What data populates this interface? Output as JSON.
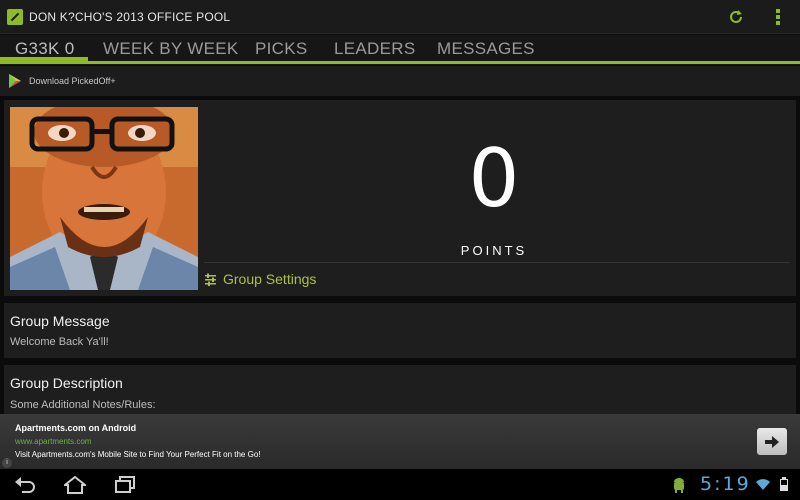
{
  "app": {
    "title": "DON K?CHO'S 2013 OFFICE POOL"
  },
  "tabs": [
    {
      "label": "G33K 0",
      "active": true
    },
    {
      "label": "WEEK BY WEEK",
      "active": false
    },
    {
      "label": "PICKS",
      "active": false
    },
    {
      "label": "LEADERS",
      "active": false
    },
    {
      "label": "MESSAGES",
      "active": false
    }
  ],
  "promo": {
    "label": "Download PickedOff+"
  },
  "profile": {
    "points_value": "0",
    "points_label": "POINTS",
    "settings_label": "Group Settings"
  },
  "group_message": {
    "title": "Group Message",
    "body": "Welcome Back Ya'll!"
  },
  "group_description": {
    "title": "Group Description",
    "body": "Some Additional Notes/Rules:"
  },
  "ad": {
    "title": "Apartments.com on Android",
    "url": "www.apartments.com",
    "description": "Visit Apartments.com's Mobile Site to Find Your Perfect Fit on the Go!"
  },
  "system": {
    "clock": "5:19"
  },
  "colors": {
    "accent": "#8dbb27",
    "settings_text": "#a9c23f",
    "clock": "#5aa9d6",
    "ad_url": "#6db33f"
  }
}
